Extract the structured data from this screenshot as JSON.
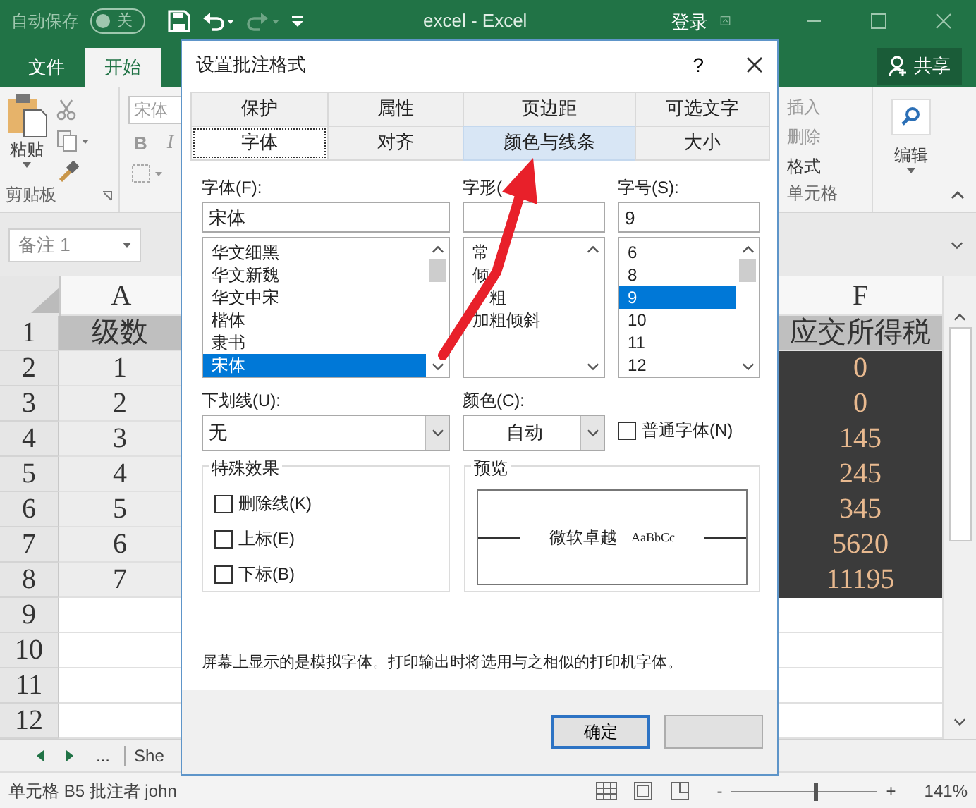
{
  "title_bar": {
    "autosave_label": "自动保存",
    "autosave_toggle": {
      "label": "关",
      "on": false
    },
    "title": "excel  -  Excel",
    "signin": "登录"
  },
  "ribbon_tabs": [
    {
      "label": "文件",
      "selected": false
    },
    {
      "label": "开始",
      "selected": true
    }
  ],
  "share_button": "共享",
  "ribbon": {
    "paste_label": "粘贴",
    "clipboard_group": "剪贴板",
    "font_box": "宋体",
    "bold": "B",
    "italic": "I",
    "cells_commands": [
      "插入",
      "删除",
      "格式"
    ],
    "cells_group": "单元格",
    "editing_label": "编辑"
  },
  "name_box": "备注 1",
  "sheet": {
    "column_a": "A",
    "column_f": "F",
    "rows": [
      {
        "number": "1",
        "kind": "header",
        "a": "级数",
        "f": "应交所得税"
      },
      {
        "number": "2",
        "kind": "data",
        "a": "1",
        "f": "0"
      },
      {
        "number": "3",
        "kind": "data",
        "a": "2",
        "f": "0"
      },
      {
        "number": "4",
        "kind": "data",
        "a": "3",
        "f": "145"
      },
      {
        "number": "5",
        "kind": "data",
        "a": "4",
        "f": "245"
      },
      {
        "number": "6",
        "kind": "data",
        "a": "5",
        "f": "345"
      },
      {
        "number": "7",
        "kind": "data",
        "a": "6",
        "f": "5620"
      },
      {
        "number": "8",
        "kind": "data",
        "a": "7",
        "f": "11195"
      },
      {
        "number": "9",
        "kind": "empty"
      },
      {
        "number": "10",
        "kind": "empty"
      },
      {
        "number": "11",
        "kind": "empty"
      },
      {
        "number": "12",
        "kind": "empty"
      }
    ]
  },
  "sheet_tabs": {
    "more": "...",
    "tab": "She"
  },
  "status_bar": {
    "text": "单元格 B5 批注者 john",
    "zoom_out": "-",
    "zoom_slider": {
      "level": 0.56
    },
    "zoom_in": "+",
    "zoom": "141%"
  },
  "dialog": {
    "title": "设置批注格式",
    "help": "?",
    "tab_rows": [
      [
        {
          "label": "保护",
          "selected": false,
          "hovered": false
        },
        {
          "label": "属性",
          "selected": false,
          "hovered": false
        },
        {
          "label": "页边距",
          "selected": false,
          "hovered": false
        },
        {
          "label": "可选文字",
          "selected": false,
          "hovered": false
        }
      ],
      [
        {
          "label": "字体",
          "selected": true,
          "hovered": false
        },
        {
          "label": "对齐",
          "selected": false,
          "hovered": false
        },
        {
          "label": "颜色与线条",
          "selected": false,
          "hovered": true
        },
        {
          "label": "大小",
          "selected": false,
          "hovered": false
        }
      ]
    ],
    "pickers": [
      {
        "label": "字体(F):",
        "value": "宋体",
        "items": [
          {
            "label": "华文细黑",
            "selected": false
          },
          {
            "label": "华文新魏",
            "selected": false
          },
          {
            "label": "华文中宋",
            "selected": false
          },
          {
            "label": "楷体",
            "selected": false
          },
          {
            "label": "隶书",
            "selected": false
          },
          {
            "label": "宋体",
            "selected": true
          }
        ]
      },
      {
        "label": "字形(",
        "items": [
          {
            "label": "常",
            "selected": false,
            "lead_covered": false
          },
          {
            "label": "倾",
            "selected": false,
            "lead_covered": false
          },
          {
            "label": "粗",
            "selected": false,
            "lead_covered": true
          },
          {
            "label": "加粗倾斜",
            "selected": false,
            "lead_covered": false
          }
        ]
      },
      {
        "label": "字号(S):",
        "value": "9",
        "items": [
          {
            "label": "6",
            "selected": false
          },
          {
            "label": "8",
            "selected": false
          },
          {
            "label": "9",
            "selected": true
          },
          {
            "label": "10",
            "selected": false
          },
          {
            "label": "11",
            "selected": false
          },
          {
            "label": "12",
            "selected": false
          }
        ]
      }
    ],
    "underline": {
      "label": "下划线(U):",
      "value": "无"
    },
    "color": {
      "label": "颜色(C):",
      "value": "自动"
    },
    "normal_font": {
      "label": "普通字体(N)",
      "checked": false
    },
    "effects": {
      "title": "特殊效果",
      "options": [
        {
          "label": "删除线(K)",
          "checked": false
        },
        {
          "label": "上标(E)",
          "checked": false
        },
        {
          "label": "下标(B)",
          "checked": false
        }
      ]
    },
    "preview": {
      "title": "预览",
      "sample_cjk": "微软卓越",
      "sample_latin": "AaBbCc"
    },
    "note": "屏幕上显示的是模拟字体。打印输出时将选用与之相似的打印机字体。",
    "ok_button": "确定"
  }
}
